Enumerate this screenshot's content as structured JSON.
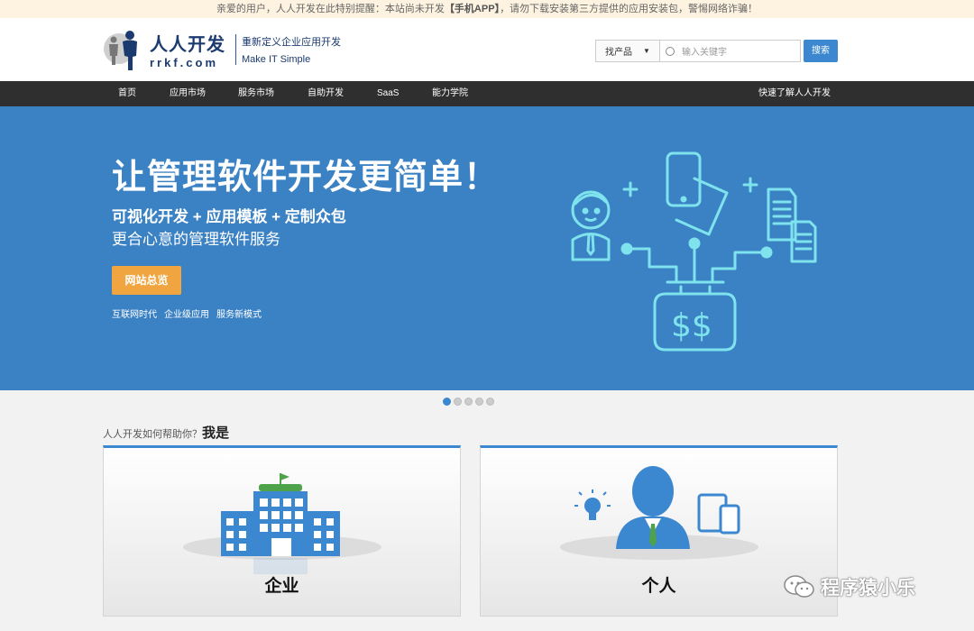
{
  "notice": {
    "before": "亲爱的用户，人人开发在此特别提醒：本站尚未开发",
    "highlight": "【手机APP】",
    "after": "，请勿下载安装第三方提供的应用安装包，警惕网络诈骗！"
  },
  "logo": {
    "cn": "人人开发",
    "en": "rrkf.com"
  },
  "slogan": {
    "line1": "重新定义企业应用开发",
    "line2": "Make  IT  Simple"
  },
  "search": {
    "select_value": "找产品",
    "placeholder": "输入关键字",
    "button": "搜索"
  },
  "nav": {
    "items": [
      "首页",
      "应用市场",
      "服务市场",
      "自助开发",
      "SaaS",
      "能力学院"
    ],
    "right": "快速了解人人开发"
  },
  "banner": {
    "title": "让管理软件开发更简单！",
    "sub1": "可视化开发 + 应用模板 + 定制众包",
    "sub2": "更合心意的管理软件服务",
    "button": "网站总览",
    "tags": [
      "互联网时代",
      "企业级应用",
      "服务新模式"
    ],
    "accent": "#3b82c4"
  },
  "carousel": {
    "count": 5,
    "active": 0
  },
  "help": {
    "prefix": "人人开发如何帮助你？",
    "bold": "我是"
  },
  "cards": [
    {
      "label": "企业",
      "icon": "building-icon"
    },
    {
      "label": "个人",
      "icon": "person-icon"
    }
  ],
  "watermark": {
    "text": "程序猿小乐",
    "icon": "wechat-icon"
  },
  "colors": {
    "primary": "#3b87d0",
    "nav_bg": "#2f2f2f",
    "button_orange": "#f0a540"
  }
}
